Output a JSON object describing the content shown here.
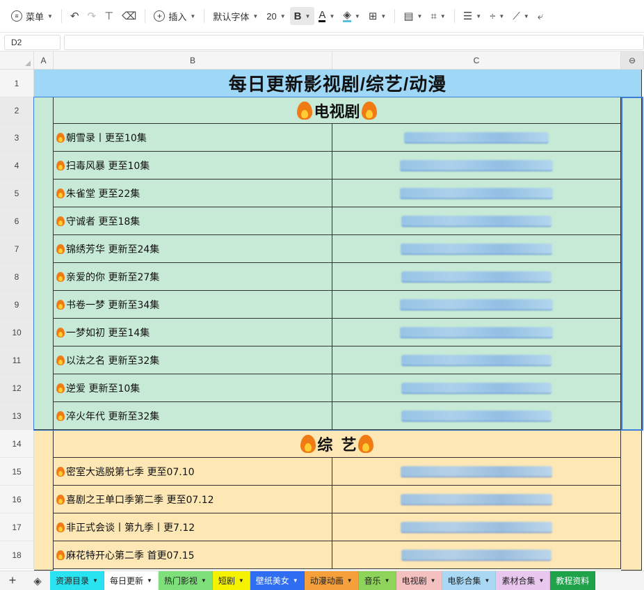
{
  "toolbar": {
    "menu_label": "菜单",
    "insert_label": "插入",
    "font_name": "默认字体",
    "font_size": "20",
    "bold_label": "B",
    "font_color_label": "A"
  },
  "formula_bar": {
    "cell_ref": "D2",
    "value": ""
  },
  "columns": [
    {
      "name": "A"
    },
    {
      "name": "B"
    },
    {
      "name": "C"
    }
  ],
  "rows": {
    "r1": "1",
    "r2": "2",
    "r3": "3",
    "r4": "4",
    "r5": "5",
    "r6": "6",
    "r7": "7",
    "r8": "8",
    "r9": "9",
    "r10": "10",
    "r11": "11",
    "r12": "12",
    "r13": "13",
    "r14": "14",
    "r15": "15",
    "r16": "16",
    "r17": "17",
    "r18": "18"
  },
  "sheet": {
    "title": "每日更新影视剧/综艺/动漫",
    "section_tv": "电视剧",
    "section_variety": "综  艺",
    "tv_items": [
      "朝雪录丨更至10集",
      "扫毒风暴 更至10集",
      "朱雀堂 更至22集",
      "守诚者 更至18集",
      "锦绣芳华 更新至24集",
      "亲爱的你 更新至27集",
      "书卷一梦 更新至34集",
      "一梦如初 更至14集",
      "以法之名 更新至32集",
      "逆爱 更新至10集",
      "淬火年代 更新至32集"
    ],
    "variety_items": [
      "密室大逃脱第七季 更至07.10",
      "喜剧之王单口季第二季 更至07.12",
      "非正式会谈丨第九季丨更7.12",
      "麻花特开心第二季 首更07.15"
    ]
  },
  "tabs": [
    {
      "label": "资源目录",
      "color": "#29e3f0"
    },
    {
      "label": "每日更新",
      "color": "#ffffff"
    },
    {
      "label": "热门影视",
      "color": "#7ee07a"
    },
    {
      "label": "短剧",
      "color": "#f5f200"
    },
    {
      "label": "壁纸美女",
      "color": "#2f6ef0"
    },
    {
      "label": "动漫动画",
      "color": "#f5a03a"
    },
    {
      "label": "音乐",
      "color": "#8fd45a"
    },
    {
      "label": "电视剧",
      "color": "#f4c0c0"
    },
    {
      "label": "电影合集",
      "color": "#a9d8f5"
    },
    {
      "label": "素材合集",
      "color": "#e9c8f0"
    },
    {
      "label": "教程资料",
      "color": "#1ea34a"
    }
  ]
}
